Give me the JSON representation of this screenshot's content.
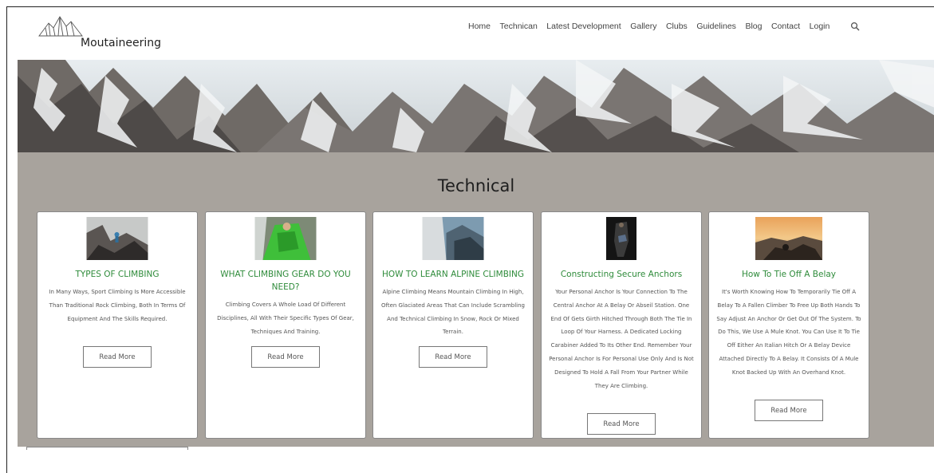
{
  "header": {
    "brand": "Moutaineering",
    "nav": [
      "Home",
      "Technican",
      "Latest Development",
      "Gallery",
      "Clubs",
      "Guidelines",
      "Blog",
      "Contact",
      "Login"
    ]
  },
  "section": {
    "title": "Technical",
    "cards": [
      {
        "title": "TYPES OF CLIMBING",
        "text": "In Many Ways, Sport Climbing Is More Accessible Than Traditional Rock Climbing, Both In Terms Of Equipment And The Skills Required.",
        "button": "Read More"
      },
      {
        "title": "WHAT CLIMBING GEAR DO YOU NEED?",
        "text": "Climbing Covers A Whole Load Of Different Disciplines, All With Their Specific Types Of Gear, Techniques And Training.",
        "button": "Read More"
      },
      {
        "title": "HOW TO LEARN ALPINE CLIMBING",
        "text": "Alpine Climbing Means Mountain Climbing In High, Often Glaciated Areas That Can Include Scrambling And Technical Climbing In Snow, Rock Or Mixed Terrain.",
        "button": "Read More"
      },
      {
        "title": "Constructing Secure Anchors",
        "text": "Your Personal Anchor Is Your Connection To The Central Anchor At A Belay Or Abseil Station. One End Of Gets Girth Hitched Through Both The Tie In Loop Of Your Harness. A Dedicated Locking Carabiner Added To Its Other End. Remember Your Personal Anchor Is For Personal Use Only And Is Not Designed To Hold A Fall From Your Partner While They Are Climbing.",
        "button": "Read More"
      },
      {
        "title": "How To Tie Off A Belay",
        "text": "It's Worth Knowing How To Temporarily Tie Off A Belay To A Fallen Climber To Free Up Both Hands To Say Adjust An Anchor Or Get Out Of The System. To Do This, We Use A Mule Knot. You Can Use It To Tie Off Either An Italian Hitch Or A Belay Device Attached Directly To A Belay. It Consists Of A Mule Knot Backed Up With An Overhand Knot.",
        "button": "Read More"
      }
    ]
  },
  "colors": {
    "accent_green": "#2e8b3a",
    "section_bg": "#a8a39d"
  },
  "icons": {
    "logo": "mountain-logo-icon",
    "search": "search-icon"
  }
}
